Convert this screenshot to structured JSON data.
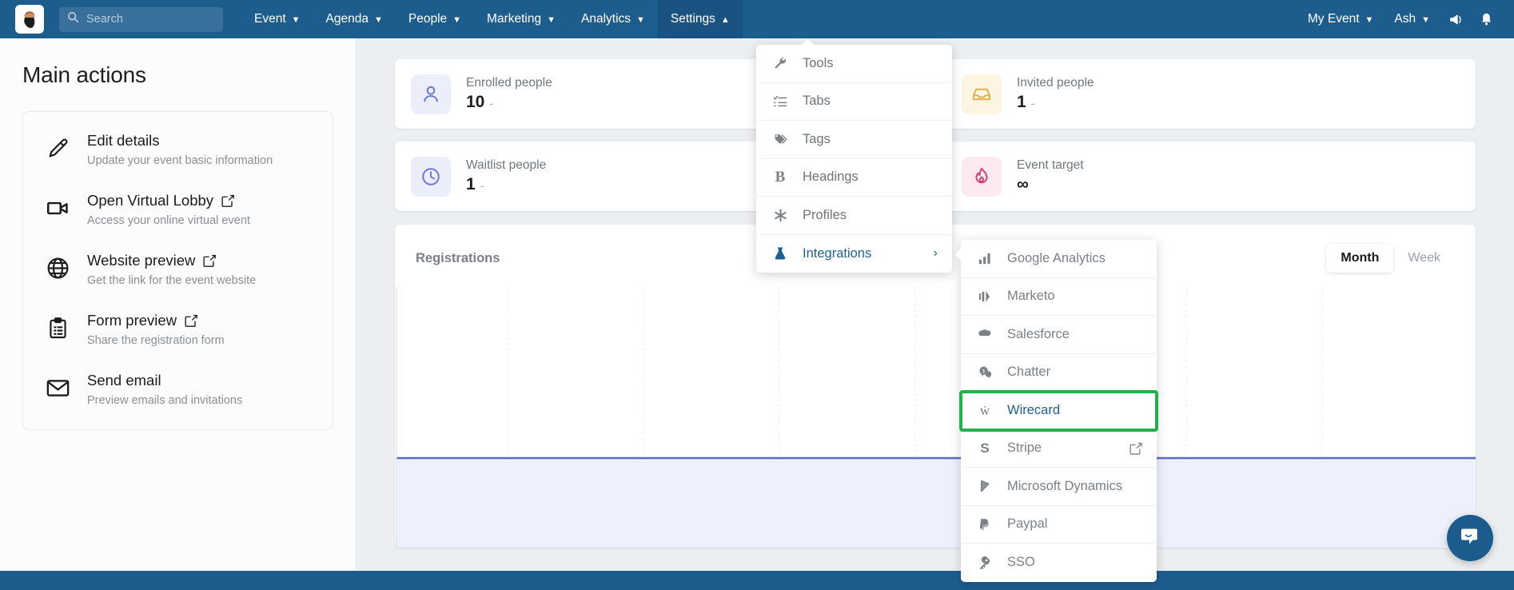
{
  "navbar": {
    "logo_alt": "event-logo",
    "search": {
      "placeholder": "Search",
      "value": ""
    },
    "items": [
      {
        "label": "Event",
        "icon": "chevron-down-icon",
        "active": false
      },
      {
        "label": "Agenda",
        "icon": "chevron-down-icon",
        "active": false
      },
      {
        "label": "People",
        "icon": "chevron-down-icon",
        "active": false
      },
      {
        "label": "Marketing",
        "icon": "chevron-down-icon",
        "active": false
      },
      {
        "label": "Analytics",
        "icon": "chevron-down-icon",
        "active": false
      },
      {
        "label": "Settings",
        "icon": "chevron-up-icon",
        "active": true
      }
    ],
    "right_items": [
      {
        "label": "My Event",
        "icon": "chevron-down-icon"
      },
      {
        "label": "Ash",
        "icon": "chevron-down-icon"
      }
    ],
    "icons": [
      {
        "name": "megaphone-icon"
      },
      {
        "name": "bell-icon"
      }
    ],
    "bg_color": "#1d5d8e",
    "active_bg_color": "#1a5381"
  },
  "sidebar": {
    "title": "Main actions",
    "actions": [
      {
        "icon": "pencil-icon",
        "title": "Edit details",
        "subtitle": "Update your event basic information",
        "external": false
      },
      {
        "icon": "video-icon",
        "title": "Open Virtual Lobby",
        "subtitle": "Access your online virtual event",
        "external": true
      },
      {
        "icon": "globe-icon",
        "title": "Website preview",
        "subtitle": "Get the link for the event website",
        "external": true
      },
      {
        "icon": "clipboard-icon",
        "title": "Form preview",
        "subtitle": "Share the registration form",
        "external": true
      },
      {
        "icon": "envelope-icon",
        "title": "Send email",
        "subtitle": "Preview emails and invitations",
        "external": false
      }
    ]
  },
  "main": {
    "stats": [
      {
        "icon": "person-icon",
        "label": "Enrolled people",
        "value": "10",
        "delta": "-",
        "accent": "#6b77d6",
        "bg": "#eceefb"
      },
      {
        "icon": "inbox-icon",
        "label": "Invited people",
        "value": "1",
        "delta": "-",
        "accent": "#e0b04a",
        "bg": "#fdf4e2"
      },
      {
        "icon": "clock-icon",
        "label": "Waitlist people",
        "value": "1",
        "delta": "-",
        "accent": "#6b77d6",
        "bg": "#eceefb"
      },
      {
        "icon": "flame-icon",
        "label": "Event target",
        "value": "∞",
        "delta": "",
        "accent": "#dd3f73",
        "bg": "#fdeaf0"
      }
    ],
    "chart_panel": {
      "title": "Registrations",
      "segments": [
        {
          "label": "Month",
          "active": true
        },
        {
          "label": "Week",
          "active": false
        }
      ]
    }
  },
  "chart_data": {
    "type": "area",
    "title": "Registrations",
    "categories": [
      "",
      "",
      "",
      "",
      "",
      "",
      "",
      ""
    ],
    "values": [
      0,
      0,
      0,
      0,
      0,
      0,
      0,
      0
    ],
    "series": [
      {
        "name": "Registrations",
        "values": [
          0,
          0,
          0,
          0,
          0,
          0,
          0,
          0
        ]
      }
    ],
    "xlabel": "",
    "ylabel": "",
    "ylim": [
      0,
      10
    ],
    "grid": true,
    "legend": "none",
    "line_color": "#5c6bc0",
    "fill_color": "#eef0fb"
  },
  "settings_menu": {
    "items": [
      {
        "icon": "wrench-icon",
        "label": "Tools",
        "highlight": false,
        "submenu": false
      },
      {
        "icon": "checklist-icon",
        "label": "Tabs",
        "highlight": false,
        "submenu": false
      },
      {
        "icon": "tags-icon",
        "label": "Tags",
        "highlight": false,
        "submenu": false
      },
      {
        "icon": "bold-b-icon",
        "label": "Headings",
        "highlight": false,
        "submenu": false
      },
      {
        "icon": "asterisk-icon",
        "label": "Profiles",
        "highlight": false,
        "submenu": false
      },
      {
        "icon": "flask-icon",
        "label": "Integrations",
        "highlight": true,
        "submenu": true,
        "chevron": "›"
      }
    ]
  },
  "integrations_submenu": {
    "selection_color": "#22b14c",
    "items": [
      {
        "icon": "bar-chart-icon",
        "label": "Google Analytics",
        "selected": false,
        "external": false
      },
      {
        "icon": "marketo-icon",
        "label": "Marketo",
        "selected": false,
        "external": false
      },
      {
        "icon": "salesforce-cloud-icon",
        "label": "Salesforce",
        "selected": false,
        "external": false
      },
      {
        "icon": "chatter-icon",
        "label": "Chatter",
        "selected": false,
        "external": false
      },
      {
        "icon": "wirecard-w-icon",
        "label": "Wirecard",
        "selected": true,
        "external": false
      },
      {
        "icon": "stripe-s-icon",
        "label": "Stripe",
        "selected": false,
        "external": true
      },
      {
        "icon": "dynamics-icon",
        "label": "Microsoft Dynamics",
        "selected": false,
        "external": false
      },
      {
        "icon": "paypal-icon",
        "label": "Paypal",
        "selected": false,
        "external": false
      },
      {
        "icon": "key-icon",
        "label": "SSO",
        "selected": false,
        "external": false
      }
    ]
  },
  "intercom": {
    "icon": "chat-bubble-icon",
    "color": "#1b5c8c"
  }
}
